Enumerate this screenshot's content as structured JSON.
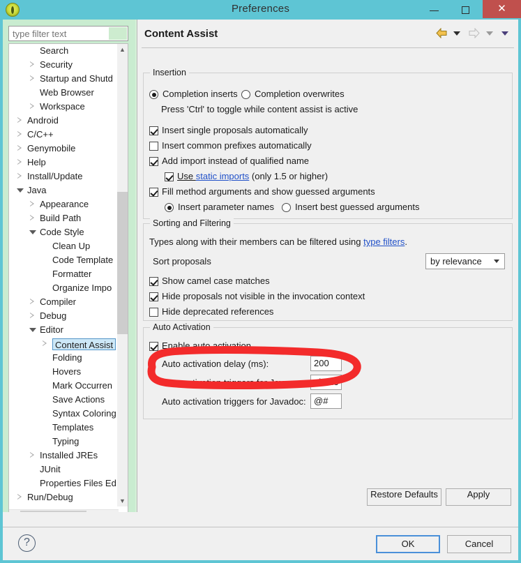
{
  "window": {
    "title": "Preferences",
    "icon": "eclipse-icon",
    "minimize": "minimize-icon",
    "maximize": "maximize-icon",
    "close": "close-icon"
  },
  "filter": {
    "placeholder": "type filter text",
    "value": ""
  },
  "tree": {
    "items": [
      {
        "label": "Search",
        "indent": 2,
        "state": "leaf",
        "selected": false
      },
      {
        "label": "Security",
        "indent": 2,
        "state": "collapsed",
        "selected": false
      },
      {
        "label": "Startup and Shutd",
        "indent": 2,
        "state": "collapsed",
        "selected": false
      },
      {
        "label": "Web Browser",
        "indent": 2,
        "state": "leaf",
        "selected": false
      },
      {
        "label": "Workspace",
        "indent": 2,
        "state": "collapsed",
        "selected": false
      },
      {
        "label": "Android",
        "indent": 1,
        "state": "collapsed",
        "selected": false
      },
      {
        "label": "C/C++",
        "indent": 1,
        "state": "collapsed",
        "selected": false
      },
      {
        "label": "Genymobile",
        "indent": 1,
        "state": "collapsed",
        "selected": false
      },
      {
        "label": "Help",
        "indent": 1,
        "state": "collapsed",
        "selected": false
      },
      {
        "label": "Install/Update",
        "indent": 1,
        "state": "collapsed",
        "selected": false
      },
      {
        "label": "Java",
        "indent": 1,
        "state": "expanded",
        "selected": false
      },
      {
        "label": "Appearance",
        "indent": 2,
        "state": "collapsed",
        "selected": false
      },
      {
        "label": "Build Path",
        "indent": 2,
        "state": "collapsed",
        "selected": false
      },
      {
        "label": "Code Style",
        "indent": 2,
        "state": "expanded",
        "selected": false
      },
      {
        "label": "Clean Up",
        "indent": 3,
        "state": "leaf",
        "selected": false
      },
      {
        "label": "Code Template",
        "indent": 3,
        "state": "leaf",
        "selected": false
      },
      {
        "label": "Formatter",
        "indent": 3,
        "state": "leaf",
        "selected": false
      },
      {
        "label": "Organize Impo",
        "indent": 3,
        "state": "leaf",
        "selected": false
      },
      {
        "label": "Compiler",
        "indent": 2,
        "state": "collapsed",
        "selected": false
      },
      {
        "label": "Debug",
        "indent": 2,
        "state": "collapsed",
        "selected": false
      },
      {
        "label": "Editor",
        "indent": 2,
        "state": "expanded",
        "selected": false
      },
      {
        "label": "Content Assist",
        "indent": 3,
        "state": "collapsed",
        "selected": true
      },
      {
        "label": "Folding",
        "indent": 3,
        "state": "leaf",
        "selected": false
      },
      {
        "label": "Hovers",
        "indent": 3,
        "state": "leaf",
        "selected": false
      },
      {
        "label": "Mark Occurren",
        "indent": 3,
        "state": "leaf",
        "selected": false
      },
      {
        "label": "Save Actions",
        "indent": 3,
        "state": "leaf",
        "selected": false
      },
      {
        "label": "Syntax Coloring",
        "indent": 3,
        "state": "leaf",
        "selected": false
      },
      {
        "label": "Templates",
        "indent": 3,
        "state": "leaf",
        "selected": false
      },
      {
        "label": "Typing",
        "indent": 3,
        "state": "leaf",
        "selected": false
      },
      {
        "label": "Installed JREs",
        "indent": 2,
        "state": "collapsed",
        "selected": false
      },
      {
        "label": "JUnit",
        "indent": 2,
        "state": "leaf",
        "selected": false
      },
      {
        "label": "Properties Files Ed",
        "indent": 2,
        "state": "leaf",
        "selected": false
      },
      {
        "label": "Run/Debug",
        "indent": 1,
        "state": "collapsed",
        "selected": false
      }
    ]
  },
  "page": {
    "title": "Content Assist",
    "nav": {
      "back": "back-arrow-icon",
      "back_menu": "back-dropdown-icon",
      "forward": "forward-arrow-icon",
      "forward_menu": "forward-dropdown-icon",
      "view_menu": "view-menu-icon"
    }
  },
  "insertion": {
    "group_title": "Insertion",
    "radio_inserts": {
      "label": "Completion inserts",
      "checked": true
    },
    "radio_overwrites": {
      "label": "Completion overwrites",
      "checked": false
    },
    "hint": "Press 'Ctrl' to toggle while content assist is active",
    "cb_single": {
      "label": "Insert single proposals automatically",
      "checked": true
    },
    "cb_prefixes": {
      "label": "Insert common prefixes automatically",
      "checked": false
    },
    "cb_import": {
      "label": "Add import instead of qualified name",
      "checked": true
    },
    "cb_static": {
      "prefix": "Use ",
      "link": "static imports",
      "suffix": " (only 1.5 or higher)",
      "checked": true
    },
    "cb_fill": {
      "label": "Fill method arguments and show guessed arguments",
      "checked": true
    },
    "radio_param_names": {
      "label": "Insert parameter names",
      "checked": true
    },
    "radio_best_guess": {
      "label": "Insert best guessed arguments",
      "checked": false
    }
  },
  "sorting": {
    "group_title": "Sorting and Filtering",
    "types_prefix": "Types along with their members can be filtered using ",
    "types_link": "type filters",
    "types_suffix": ".",
    "sort_label": "Sort proposals",
    "sort_value": "by relevance",
    "cb_camel": {
      "label": "Show camel case matches",
      "checked": true
    },
    "cb_hide_invisible": {
      "label": "Hide proposals not visible in the invocation context",
      "checked": true
    },
    "cb_hide_deprecated": {
      "label": "Hide deprecated references",
      "checked": false
    }
  },
  "auto_activation": {
    "group_title": "Auto Activation",
    "cb_enable": {
      "label": "Enable auto activation",
      "checked": true
    },
    "delay_label": "Auto activation delay (ms):",
    "delay_value": "200",
    "java_label": "Auto activation triggers for Java:",
    "java_value": "abcde",
    "javadoc_label": "Auto activation triggers for Javadoc:",
    "javadoc_value": "@#"
  },
  "buttons": {
    "restore_defaults": "Restore Defaults",
    "apply": "Apply",
    "ok": "OK",
    "cancel": "Cancel",
    "help": "?"
  },
  "annotation": {
    "shape": "red-ellipse-highlight",
    "color": "#f32b2b"
  },
  "colors": {
    "titlebar": "#5ec5d4",
    "close_button": "#c0504d",
    "tree_selection": "#cde8f7",
    "sidebar_bg": "#c9ecd0",
    "link": "#2050c8",
    "annotation_red": "#f32b2b"
  }
}
